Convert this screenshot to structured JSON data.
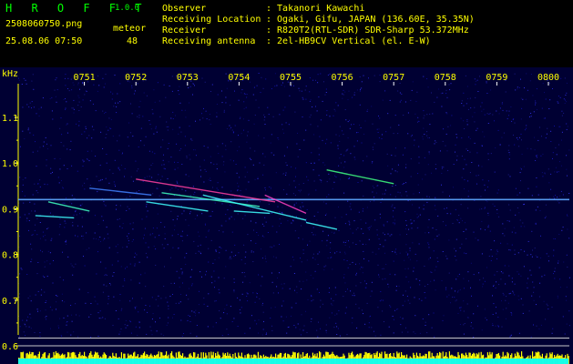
{
  "header": {
    "title": "H R O F F T",
    "version": "1.0.0",
    "filename": "2508060750.png",
    "datetime": "25.08.06 07:50",
    "meteor_label": "meteor",
    "meteor_count": "48",
    "info": [
      {
        "label": "Observer",
        "value": ": Takanori Kawachi"
      },
      {
        "label": "Receiving Location",
        "value": ": Ogaki, Gifu, JAPAN (136.60E, 35.35N)"
      },
      {
        "label": "Receiver",
        "value": ": R820T2(RTL-SDR) SDR-Sharp 53.372MHz"
      },
      {
        "label": "Receiving antenna",
        "value": ": 2el-HB9CV Vertical (el. E-W)"
      }
    ]
  },
  "colors": {
    "text_header": "#ffff00",
    "title": "#00ff00",
    "axis": "#ffffff",
    "background": "#000033"
  },
  "chart_data": {
    "type": "heatmap",
    "ylabel": "kHz",
    "x_ticks": [
      "0751",
      "0752",
      "0753",
      "0754",
      "0755",
      "0756",
      "0757",
      "0758",
      "0759",
      "0800"
    ],
    "y_ticks": [
      "1.1",
      "1.0",
      "0.9",
      "0.8",
      "0.7",
      "0.6"
    ],
    "x_range_minutes": [
      0,
      10
    ],
    "y_range_khz": [
      0.58,
      1.2
    ],
    "carrier_khz": 0.92,
    "echoes": [
      {
        "t0": 2.0,
        "t1": 4.7,
        "f0": 0.965,
        "f1": 0.915,
        "color": "#ff40a0"
      },
      {
        "t0": 2.5,
        "t1": 4.4,
        "f0": 0.935,
        "f1": 0.905,
        "color": "#40ffc0"
      },
      {
        "t0": 3.3,
        "t1": 5.3,
        "f0": 0.93,
        "f1": 0.875,
        "color": "#40ffff"
      },
      {
        "t0": 4.5,
        "t1": 5.3,
        "f0": 0.93,
        "f1": 0.89,
        "color": "#ff40c0"
      },
      {
        "t0": 5.7,
        "t1": 7.0,
        "f0": 0.985,
        "f1": 0.955,
        "color": "#40ff80"
      },
      {
        "t0": 0.05,
        "t1": 0.8,
        "f0": 0.885,
        "f1": 0.88,
        "color": "#40ffff"
      },
      {
        "t0": 0.3,
        "t1": 1.1,
        "f0": 0.915,
        "f1": 0.895,
        "color": "#40ffc0"
      },
      {
        "t0": 2.2,
        "t1": 3.4,
        "f0": 0.915,
        "f1": 0.895,
        "color": "#40ffff"
      },
      {
        "t0": 3.9,
        "t1": 4.6,
        "f0": 0.895,
        "f1": 0.89,
        "color": "#40ffff"
      },
      {
        "t0": 5.3,
        "t1": 5.9,
        "f0": 0.87,
        "f1": 0.855,
        "color": "#40ffff"
      },
      {
        "t0": 1.1,
        "t1": 2.3,
        "f0": 0.945,
        "f1": 0.93,
        "color": "#4080ff"
      }
    ]
  }
}
